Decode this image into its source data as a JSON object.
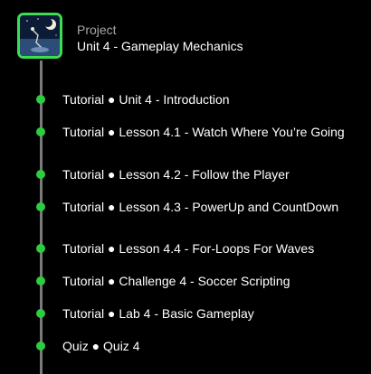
{
  "project": {
    "kind_label": "Project",
    "title": "Unit 4 - Gameplay Mechanics",
    "thumbnail_icon": "night-scene-thumbnail",
    "accent_color": "#3ddc52"
  },
  "timeline": {
    "dot_color": "#2ecc40",
    "items": [
      {
        "text": "Tutorial ● Unit 4 - Introduction"
      },
      {
        "text": "Tutorial ● Lesson 4.1 - Watch Where You’re Going"
      },
      {
        "text": "Tutorial ● Lesson 4.2 - Follow the Player"
      },
      {
        "text": "Tutorial ● Lesson 4.3 - PowerUp and CountDown"
      },
      {
        "text": "Tutorial ● Lesson 4.4 - For-Loops For Waves"
      },
      {
        "text": "Tutorial ● Challenge 4 - Soccer Scripting"
      },
      {
        "text": "Tutorial ● Lab 4 - Basic Gameplay"
      },
      {
        "text": "Quiz ● Quiz 4"
      }
    ]
  }
}
